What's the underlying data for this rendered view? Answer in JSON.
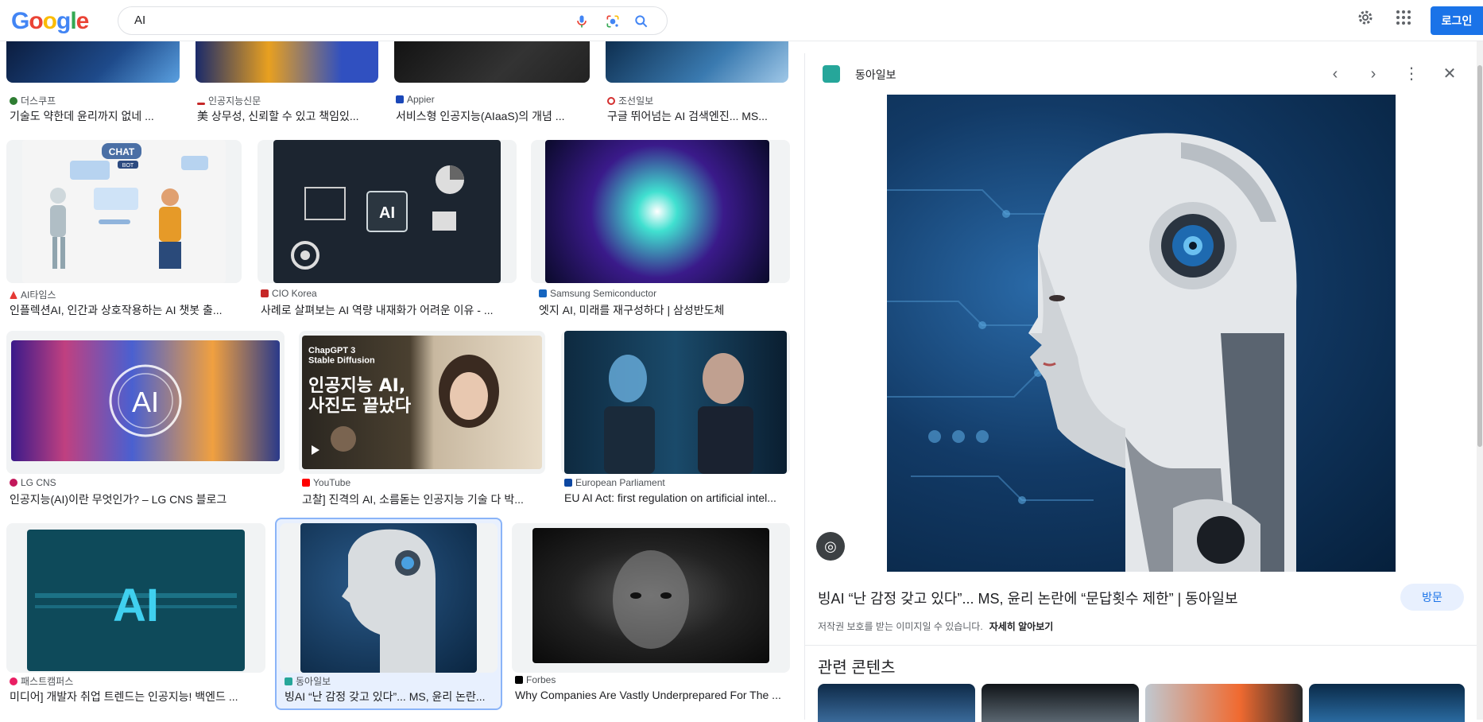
{
  "header": {
    "logo": [
      "G",
      "o",
      "o",
      "g",
      "l",
      "e"
    ],
    "search_value": "AI",
    "login_label": "로그인",
    "icons": [
      "mic-icon",
      "lens-icon",
      "search-icon",
      "gear-icon",
      "apps-icon"
    ]
  },
  "results": [
    {
      "source": "더스쿠프",
      "title": "기술도 약한데 윤리까지 없네 ..."
    },
    {
      "source": "인공지능신문",
      "title": "美 상무성, 신뢰할 수 있고 책임있..."
    },
    {
      "source": "Appier",
      "title": "서비스형 인공지능(AIaaS)의 개념 ..."
    },
    {
      "source": "조선일보",
      "title": "구글 뛰어넘는 AI 검색엔진... MS..."
    },
    {
      "source": "AI타임스",
      "title": "인플렉션AI, 인간과 상호작용하는 AI 챗봇 출..."
    },
    {
      "source": "CIO Korea",
      "title": "사례로 살펴보는 AI 역량 내재화가 어려운 이유 - ..."
    },
    {
      "source": "Samsung Semiconductor",
      "title": "엣지 AI, 미래를 재구성하다 | 삼성반도체"
    },
    {
      "source": "LG CNS",
      "title": "인공지능(AI)이란 무엇인가? – LG CNS 블로그"
    },
    {
      "source": "YouTube",
      "title": "고찰] 진격의 AI, 소름돋는 인공지능 기술 다 박..."
    },
    {
      "source": "European Parliament",
      "title": "EU AI Act: first regulation on artificial intel..."
    },
    {
      "source": "패스트캠퍼스",
      "title": "미디어] 개발자 취업 트렌드는 인공지능! 백엔드 ..."
    },
    {
      "source": "동아일보",
      "title": "빙AI “난 감정 갖고 있다”... MS, 윤리 논란..."
    },
    {
      "source": "Forbes",
      "title": "Why Companies Are Vastly Underprepared For The ..."
    }
  ],
  "thumb_text": {
    "chat": "CHAT",
    "bot": "BOT",
    "ai_chip": "AI",
    "ai_circle": "AI",
    "yt_top": "ChapGPT 3\nStable Diffusion",
    "yt_main": "인공지능 AI,\n사진도 끝났다",
    "ai_big": "AI"
  },
  "panel": {
    "site": "동아일보",
    "title": "빙AI “난 감정 갖고 있다”... MS, 윤리 논란에 “문답횟수 제한” | 동아일보",
    "visit_label": "방문",
    "copyright_note": "저작권 보호를 받는 이미지일 수 있습니다.",
    "learn_more": "자세히 알아보기",
    "related_heading": "관련 콘텐츠"
  },
  "colors": {
    "accent": "#1a73e8",
    "selected_border": "#8ab4f8"
  }
}
